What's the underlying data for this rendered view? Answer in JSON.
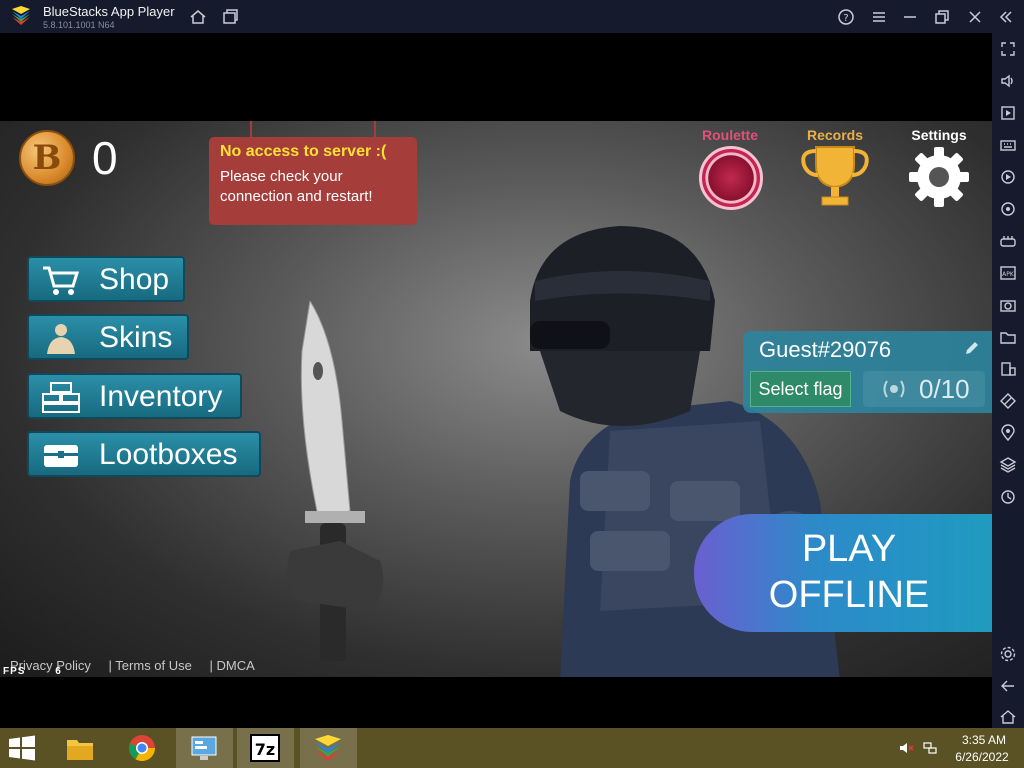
{
  "window": {
    "title": "BlueStacks App Player",
    "version": "5.8.101.1001 N64",
    "titlebar_icons": [
      "home-icon",
      "multi-instance-icon",
      "help-icon",
      "menu-icon",
      "minimize-icon",
      "restore-icon",
      "close-icon",
      "collapse-sidebar-icon"
    ]
  },
  "sidebar": {
    "icons": [
      "fullscreen-icon",
      "volume-icon",
      "media-icon",
      "keyboard-icon",
      "macro-icon",
      "rotate-icon",
      "gamepad-icon",
      "apk-icon",
      "screenshot-icon",
      "folder-icon",
      "multi-window-icon",
      "eco-mode-icon",
      "location-icon",
      "layers-icon",
      "sync-icon",
      "settings-icon",
      "back-icon",
      "home-icon"
    ]
  },
  "game": {
    "coin_symbol": "B",
    "coins": "0",
    "notice": {
      "title": "No access to server :(",
      "line1": "Please check your",
      "line2": "connection and restart!"
    },
    "menu": [
      {
        "label": "Shop",
        "icon": "cart-icon"
      },
      {
        "label": "Skins",
        "icon": "soldier-icon"
      },
      {
        "label": "Inventory",
        "icon": "crates-icon"
      },
      {
        "label": "Lootboxes",
        "icon": "chest-icon"
      }
    ],
    "top_icons": {
      "roulette": "Roulette",
      "records": "Records",
      "settings": "Settings"
    },
    "colors": {
      "roulette_label": "#e0507a",
      "records_label": "#e8b04a",
      "settings_label": "#ffffff"
    },
    "profile": {
      "name": "Guest#29076",
      "select_flag": "Select flag",
      "rank": "0/10"
    },
    "play": {
      "line1": "PLAY",
      "line2": "OFFLINE"
    },
    "footer": {
      "privacy": "Privacy Policy",
      "terms": "| Terms of Use",
      "dmca": "| DMCA"
    },
    "fps_label": "FPS",
    "fps_value": "6"
  },
  "taskbar": {
    "apps": [
      "file-explorer-icon",
      "chrome-icon",
      "control-panel-icon",
      "7zip-icon",
      "bluestacks-icon"
    ],
    "time": "3:35 AM",
    "date": "6/26/2022"
  }
}
